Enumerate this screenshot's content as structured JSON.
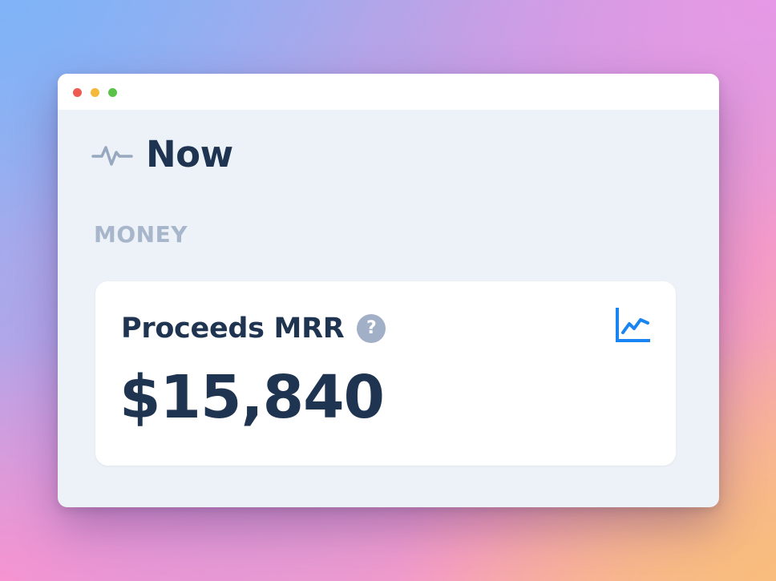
{
  "window": {
    "controls": [
      "close",
      "minimize",
      "maximize"
    ]
  },
  "header": {
    "title": "Now",
    "icon": "pulse-icon"
  },
  "section": {
    "label": "MONEY"
  },
  "metric_card": {
    "title": "Proceeds MRR",
    "help_icon": "question-mark-icon",
    "help_glyph": "?",
    "chart_icon": "line-chart-icon",
    "value": "$15,840"
  },
  "colors": {
    "accent": "#1a84f2",
    "text_primary": "#1f3450",
    "text_muted": "#a7b6cb",
    "window_bg": "#edf2f8",
    "card_bg": "#ffffff",
    "dot_red": "#ee5b52",
    "dot_yellow": "#f4b93a",
    "dot_green": "#5bc24a"
  }
}
